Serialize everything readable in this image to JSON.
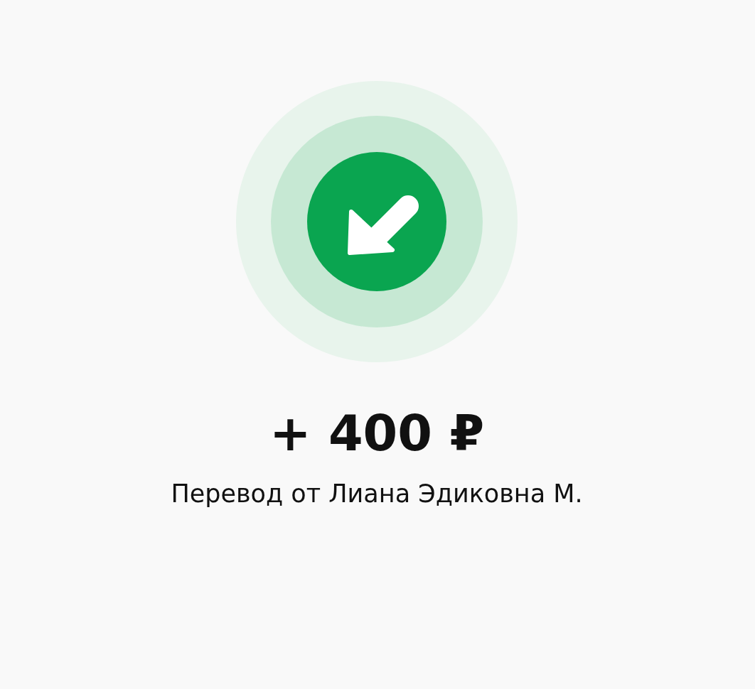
{
  "amount": "+ 400 ₽",
  "description": "Перевод от Лиана Эдиковна М."
}
